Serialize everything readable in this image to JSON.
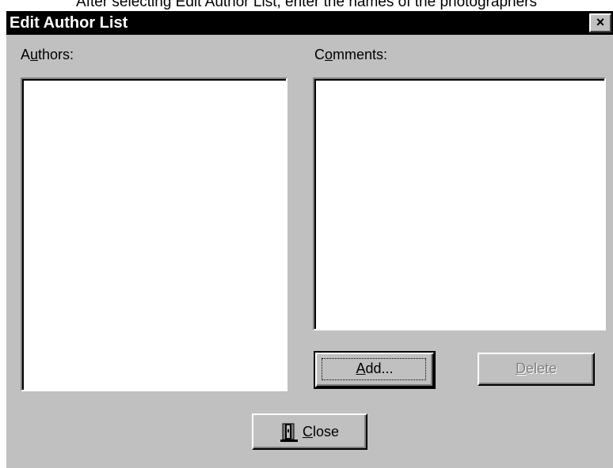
{
  "caption": "After selecting Edit Author List, enter the names of the photographers",
  "window": {
    "title": "Edit Author List",
    "close_glyph": "×"
  },
  "authors": {
    "label_first": "A",
    "label_mnemonic": "u",
    "label_rest": "thors:",
    "items": []
  },
  "comments": {
    "label_first": "C",
    "label_mnemonic": "o",
    "label_rest": "mments:",
    "text": ""
  },
  "buttons": {
    "add": {
      "mnemonic": "A",
      "rest": "dd...",
      "enabled": true
    },
    "delete": {
      "mnemonic": "D",
      "rest": "elete",
      "enabled": false
    },
    "close": {
      "mnemonic": "C",
      "rest": "lose",
      "icon": "door-exit-icon"
    }
  },
  "colors": {
    "dialog_face": "#c0c0c0",
    "titlebar": "#000000",
    "title_text": "#ffffff",
    "listbox_bg": "#ffffff"
  }
}
